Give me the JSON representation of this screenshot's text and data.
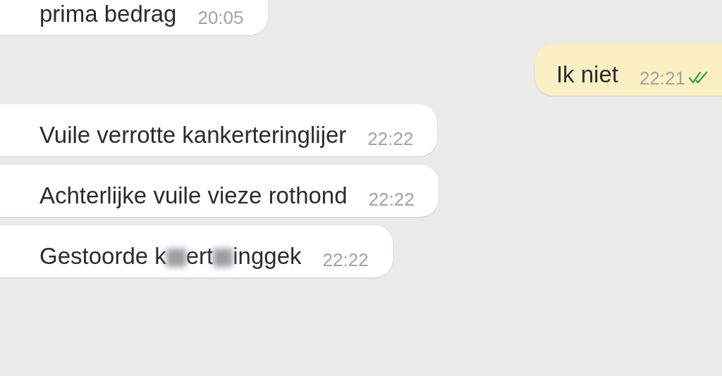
{
  "messages": [
    {
      "kind": "incoming",
      "text_parts": [
        "prima bedrag"
      ],
      "time": "20:05"
    },
    {
      "kind": "outgoing",
      "text_parts": [
        "Ik niet"
      ],
      "time": "22:21",
      "read": true
    },
    {
      "kind": "incoming",
      "text_parts": [
        "Vuile verrotte kankerteringlijer"
      ],
      "time": "22:22"
    },
    {
      "kind": "incoming",
      "text_parts": [
        "Achterlijke vuile vieze rothond"
      ],
      "time": "22:22"
    },
    {
      "kind": "incoming",
      "text_parts": [
        "Gestoorde k",
        "ert",
        "inggek"
      ],
      "time": "22:22"
    }
  ]
}
